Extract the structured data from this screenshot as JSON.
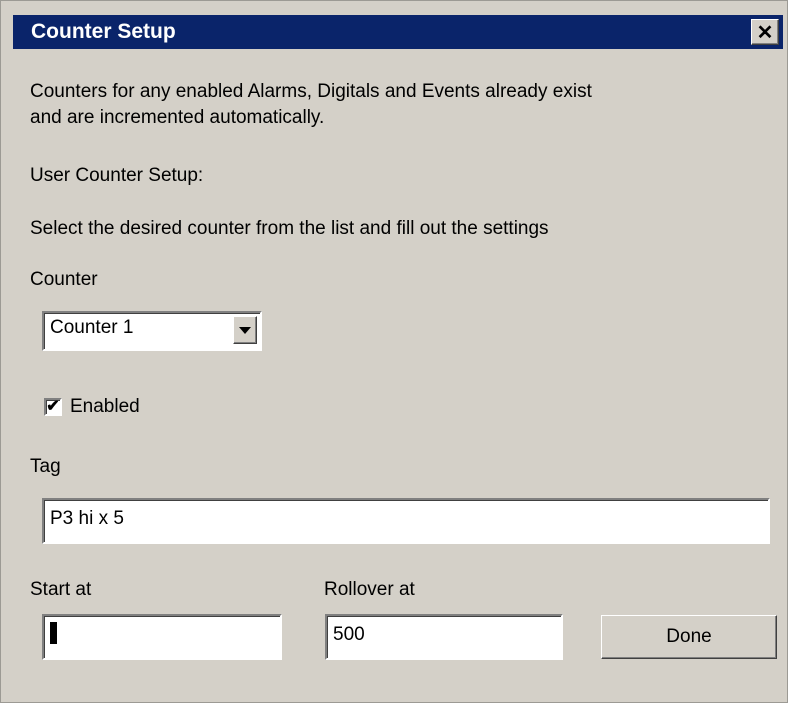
{
  "window": {
    "title": "Counter Setup",
    "close_glyph": "✕"
  },
  "info": {
    "line1": "Counters for any enabled Alarms, Digitals and Events already exist",
    "line2": "and are incremented automatically.",
    "user_setup": "User Counter Setup:",
    "instruction": "Select the desired counter from the list and fill out the settings"
  },
  "counter": {
    "label": "Counter",
    "selected": "Counter 1"
  },
  "enabled": {
    "label": "Enabled",
    "checked": true,
    "check_glyph": "✔"
  },
  "tag": {
    "label": "Tag",
    "value": "P3 hi x 5"
  },
  "start": {
    "label": "Start at",
    "value": ""
  },
  "rollover": {
    "label": "Rollover at",
    "value": "500"
  },
  "done_label": "Done"
}
